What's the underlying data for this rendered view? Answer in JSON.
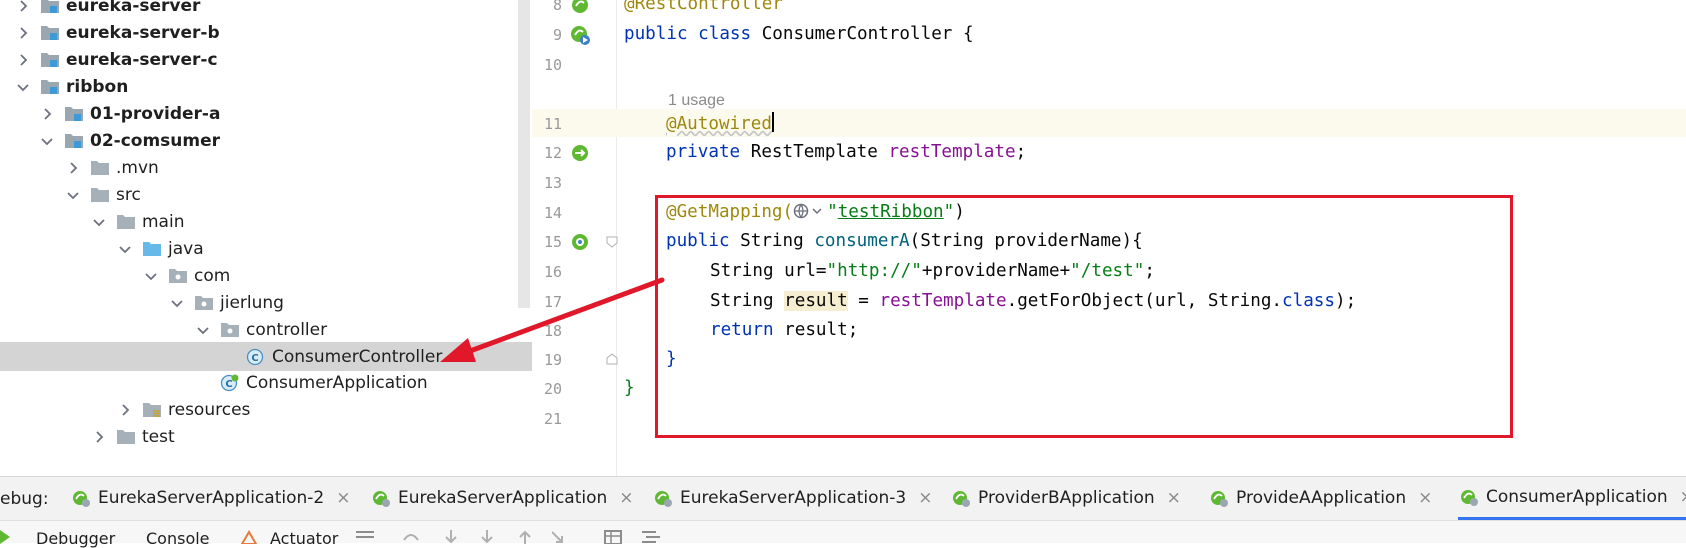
{
  "project_tree": {
    "items": [
      {
        "label": "eureka-server",
        "bold": true,
        "chevron": "right",
        "icon": "module-folder-icon"
      },
      {
        "label": "eureka-server-b",
        "bold": true,
        "chevron": "right",
        "icon": "module-folder-icon"
      },
      {
        "label": "eureka-server-c",
        "bold": true,
        "chevron": "right",
        "icon": "module-folder-icon"
      },
      {
        "label": "ribbon",
        "bold": true,
        "chevron": "down",
        "icon": "module-folder-icon"
      },
      {
        "label": "01-provider-a",
        "bold": true,
        "chevron": "right",
        "icon": "module-folder-icon"
      },
      {
        "label": "02-comsumer",
        "bold": true,
        "chevron": "down",
        "icon": "module-folder-icon"
      },
      {
        "label": ".mvn",
        "bold": false,
        "chevron": "right",
        "icon": "folder-icon"
      },
      {
        "label": "src",
        "bold": false,
        "chevron": "down",
        "icon": "folder-icon"
      },
      {
        "label": "main",
        "bold": false,
        "chevron": "down",
        "icon": "folder-icon"
      },
      {
        "label": "java",
        "bold": false,
        "chevron": "down",
        "icon": "source-folder-icon"
      },
      {
        "label": "com",
        "bold": false,
        "chevron": "down",
        "icon": "package-icon"
      },
      {
        "label": "jierlung",
        "bold": false,
        "chevron": "down",
        "icon": "package-icon"
      },
      {
        "label": "controller",
        "bold": false,
        "chevron": "down",
        "icon": "package-icon"
      },
      {
        "label": "ConsumerController",
        "bold": false,
        "chevron": "none",
        "icon": "class-icon",
        "selected": true
      },
      {
        "label": "ConsumerApplication",
        "bold": false,
        "chevron": "none",
        "icon": "spring-class-icon"
      },
      {
        "label": "resources",
        "bold": false,
        "chevron": "right",
        "icon": "resources-folder-icon"
      },
      {
        "label": "test",
        "bold": false,
        "chevron": "right",
        "icon": "folder-icon"
      }
    ]
  },
  "editor": {
    "line_numbers": [
      "8",
      "9",
      "10",
      "11",
      "12",
      "13",
      "14",
      "15",
      "16",
      "17",
      "18",
      "19",
      "20",
      "21"
    ],
    "usage_hint": "1 usage",
    "code": {
      "l8_ann": "@RestController",
      "l9_kw1": "public",
      "l9_kw2": "class",
      "l9_name": "ConsumerController {",
      "l11_ann": "@Autowired",
      "l12_kw": "private",
      "l12_type": "RestTemplate",
      "l12_field": "restTemplate",
      "l12_end": ";",
      "l14_ann": "@GetMapping(",
      "l14_str1": "\"",
      "l14_link": "testRibbon",
      "l14_str2": "\"",
      "l14_end": ")",
      "l15_kw": "public",
      "l15_type": "String",
      "l15_method": "consumerA",
      "l15_params": "(String providerName){",
      "l16_a": "String url=",
      "l16_s1": "\"http://\"",
      "l16_b": "+providerName+",
      "l16_s2": "\"/test\"",
      "l16_c": ";",
      "l17_a": "String ",
      "l17_hl": "result",
      "l17_b": " = ",
      "l17_field": "restTemplate",
      "l17_c": ".getForObject(url, String.",
      "l17_kw": "class",
      "l17_d": ");",
      "l18_kw": "return",
      "l18_b": " result;",
      "l19": "}",
      "l20": "}"
    }
  },
  "debug_panel": {
    "label": "ebug:",
    "tabs": [
      {
        "label": "EurekaServerApplication-2",
        "close": "×"
      },
      {
        "label": "EurekaServerApplication",
        "close": "×"
      },
      {
        "label": "EurekaServerApplication-3",
        "close": "×"
      },
      {
        "label": "ProviderBApplication",
        "close": "×"
      },
      {
        "label": "ProvideAApplication",
        "close": "×"
      },
      {
        "label": "ConsumerApplication",
        "close": "×",
        "active": true
      }
    ],
    "toolbar": {
      "debugger": "Debugger",
      "console": "Console",
      "actuator": "Actuator"
    }
  },
  "colors": {
    "annotation_box": "#e0182a",
    "arrow": "#e0182a",
    "selection": "#d4d4d4"
  }
}
